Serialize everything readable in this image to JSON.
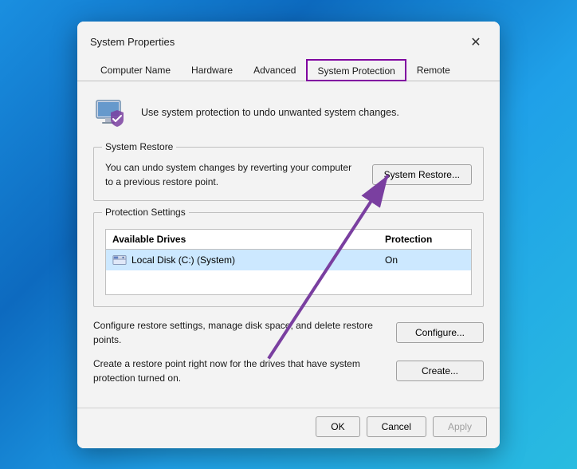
{
  "dialog": {
    "title": "System Properties",
    "close_label": "✕"
  },
  "tabs": [
    {
      "id": "computer-name",
      "label": "Computer Name",
      "active": false
    },
    {
      "id": "hardware",
      "label": "Hardware",
      "active": false
    },
    {
      "id": "advanced",
      "label": "Advanced",
      "active": false
    },
    {
      "id": "system-protection",
      "label": "System Protection",
      "active": true
    },
    {
      "id": "remote",
      "label": "Remote",
      "active": false
    }
  ],
  "header": {
    "text": "Use system protection to undo unwanted system changes."
  },
  "system_restore": {
    "section_label": "System Restore",
    "description": "You can undo system changes by reverting\nyour computer to a previous restore point.",
    "button_label": "System Restore..."
  },
  "protection_settings": {
    "section_label": "Protection Settings",
    "table": {
      "col_drive": "Available Drives",
      "col_protection": "Protection",
      "rows": [
        {
          "drive": "Local Disk (C:) (System)",
          "protection": "On"
        }
      ]
    },
    "configure": {
      "description": "Configure restore settings, manage disk space, and delete restore points.",
      "button_label": "Configure..."
    },
    "create": {
      "description": "Create a restore point right now for the drives that have system protection turned on.",
      "button_label": "Create..."
    }
  },
  "footer": {
    "ok_label": "OK",
    "cancel_label": "Cancel",
    "apply_label": "Apply"
  }
}
